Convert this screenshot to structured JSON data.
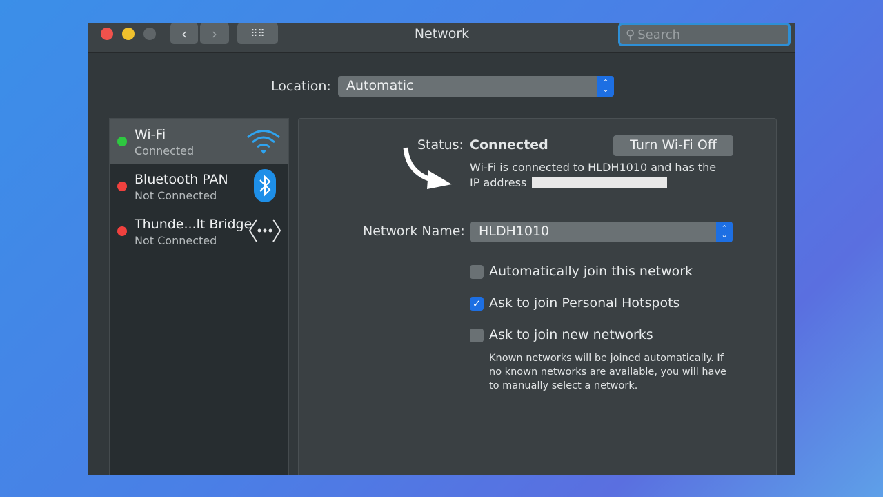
{
  "window": {
    "title": "Network",
    "search_placeholder": "Search"
  },
  "location": {
    "label": "Location:",
    "value": "Automatic"
  },
  "services": [
    {
      "name": "Wi-Fi",
      "status": "Connected",
      "dot": "#2ec840",
      "icon": "wifi-icon"
    },
    {
      "name": "Bluetooth PAN",
      "status": "Not Connected",
      "dot": "#f0413e",
      "icon": "bluetooth-icon"
    },
    {
      "name": "Thunde...lt Bridge",
      "status": "Not Connected",
      "dot": "#f0413e",
      "icon": "thunderbolt-bridge-icon"
    }
  ],
  "detail": {
    "status_label": "Status:",
    "status_value": "Connected",
    "turn_off": "Turn Wi-Fi Off",
    "description": "Wi-Fi is connected to HLDH1010 and has the",
    "ip_label": "IP address",
    "network_name_label": "Network Name:",
    "network_name": "HLDH1010",
    "options": [
      {
        "label": "Automatically join this network",
        "checked": false
      },
      {
        "label": "Ask to join Personal Hotspots",
        "checked": true
      },
      {
        "label": "Ask to join new networks",
        "checked": false
      }
    ],
    "note": "Known networks will be joined automatically. If no known networks are available, you will have to manually select a network."
  }
}
